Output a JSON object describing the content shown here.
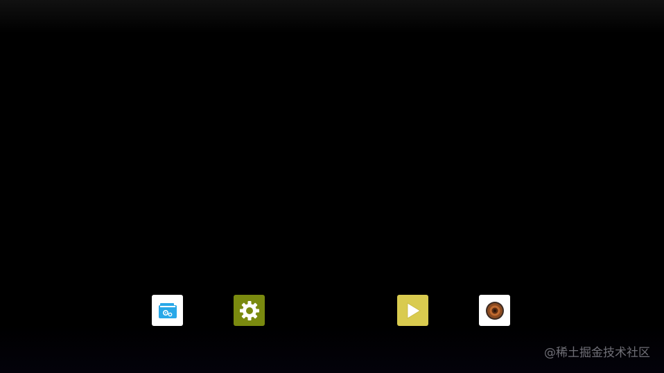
{
  "desktop": {
    "dock": [
      {
        "id": "file-manager",
        "icon": "file-manager-icon",
        "color": "#29a8e8"
      },
      {
        "id": "settings",
        "icon": "gear-icon",
        "color": "#7a8a0f"
      },
      {
        "id": "video-player",
        "icon": "play-icon",
        "color": "#d9cb4f"
      },
      {
        "id": "music-player",
        "icon": "speaker-icon",
        "color": "#8a4a20"
      }
    ]
  },
  "watermark": {
    "text": "@稀土掘金技术社区"
  },
  "colors": {
    "background": "#000000",
    "tile_white": "#ffffff"
  }
}
